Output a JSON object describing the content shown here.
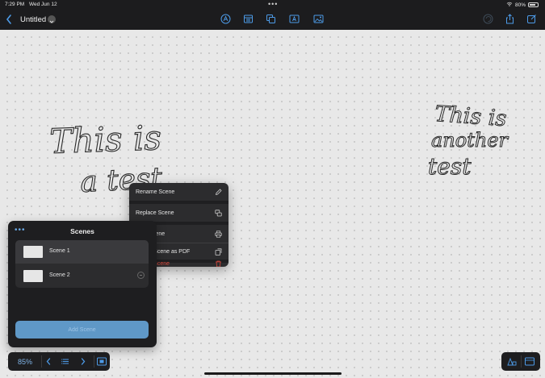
{
  "status": {
    "time": "7:29 PM",
    "date": "Wed Jun 12",
    "battery": "80%"
  },
  "toolbar": {
    "title": "Untitled"
  },
  "icons": {
    "back": "chevron-left-icon",
    "title_menu": "chevron-down-icon",
    "pen": "pen-tool-icon",
    "grid": "grid-icon",
    "shapes": "shapes-icon",
    "text": "text-icon",
    "image": "image-icon",
    "undo": "undo-icon",
    "share": "share-icon",
    "new_doc": "compose-icon"
  },
  "canvas": {
    "ink_left_line1": "This is",
    "ink_left_line2": "a test",
    "ink_right_line1": "This is",
    "ink_right_line2": "another",
    "ink_right_line3": "test"
  },
  "context_menu": {
    "items": [
      {
        "label": "Rename Scene",
        "icon": "pencil-icon"
      },
      {
        "label": "Replace Scene",
        "icon": "replace-icon"
      },
      {
        "label": "Print Scene",
        "icon": "printer-icon"
      },
      {
        "label": "Export Scene as PDF",
        "icon": "export-icon"
      },
      {
        "label": "Delete Scene",
        "icon": "trash-icon"
      }
    ]
  },
  "scenes_panel": {
    "more": "•••",
    "title": "Scenes",
    "scenes": [
      {
        "label": "Scene 1"
      },
      {
        "label": "Scene 2"
      }
    ],
    "add_label": "Add Scene"
  },
  "bottom_bar": {
    "zoom": "85%"
  },
  "colors": {
    "accent": "#5f98c7",
    "danger": "#d94a3e",
    "panel": "#1e1e20"
  }
}
